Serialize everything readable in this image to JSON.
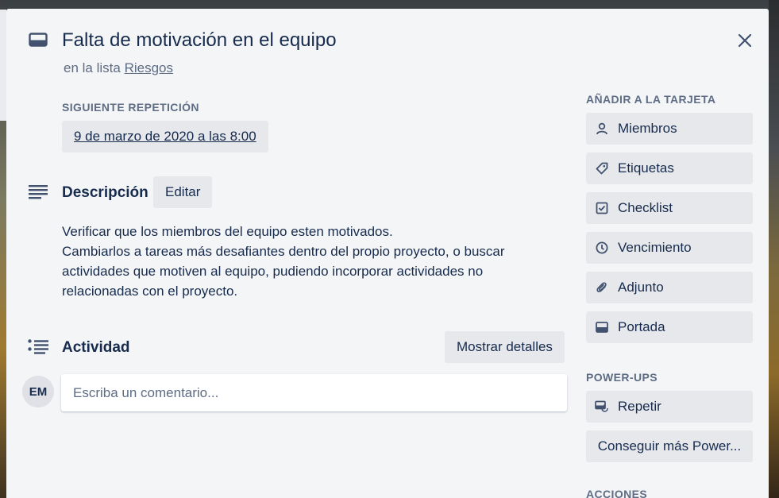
{
  "card": {
    "title": "Falta de motivación en el equipo",
    "in_list_prefix": "en la lista",
    "list_name": "Riesgos"
  },
  "recurrence": {
    "label": "Siguiente repetición",
    "value": "9 de marzo de 2020 a las 8:00"
  },
  "description": {
    "title": "Descripción",
    "edit_label": "Editar",
    "lines": [
      "Verificar que los miembros del equipo esten motivados.",
      "Cambiarlos a tareas más desafiantes dentro del propio proyecto, o buscar",
      "actividades que motiven al equipo, pudiendo incorporar actividades no",
      "relacionadas con el proyecto."
    ]
  },
  "activity": {
    "title": "Actividad",
    "show_details_label": "Mostrar detalles",
    "avatar_initials": "EM",
    "comment_placeholder": "Escriba un comentario..."
  },
  "sidebar": {
    "add_to_card_label": "Añadir a la tarjeta",
    "add_buttons": [
      {
        "label": "Miembros",
        "icon": "person-icon"
      },
      {
        "label": "Etiquetas",
        "icon": "tag-icon"
      },
      {
        "label": "Checklist",
        "icon": "checkbox-icon"
      },
      {
        "label": "Vencimiento",
        "icon": "clock-icon"
      },
      {
        "label": "Adjunto",
        "icon": "paperclip-icon"
      },
      {
        "label": "Portada",
        "icon": "cover-icon"
      }
    ],
    "powerups_label": "Power-Ups",
    "powerup_buttons": [
      {
        "label": "Repetir",
        "icon": "repeat-card-icon"
      }
    ],
    "more_powerups_label": "Conseguir más Power...",
    "actions_label": "Acciones"
  },
  "colors": {
    "modal_bg": "#f4f5f7",
    "button_bg": "#e6e8ec",
    "text": "#172b4d",
    "muted_text": "#5e6c84"
  }
}
